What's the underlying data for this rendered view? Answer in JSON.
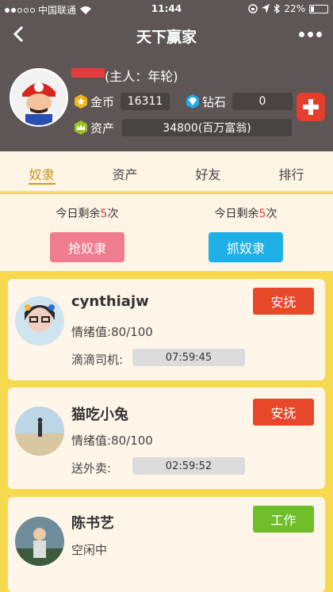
{
  "status": {
    "carrier": "中国联通",
    "time": "11:44",
    "battery": "22%",
    "battery_level": 0.22
  },
  "nav": {
    "title": "天下赢家"
  },
  "profile": {
    "owner": "(主人：年轮)",
    "gold_label": "金币",
    "gold_value": "16311",
    "diamond_label": "钻石",
    "diamond_value": "0",
    "assets_label": "资产",
    "assets_value": "34800(百万富翁)"
  },
  "tabs": [
    {
      "label": "奴隶"
    },
    {
      "label": "资产"
    },
    {
      "label": "好友"
    },
    {
      "label": "排行"
    }
  ],
  "actions": [
    {
      "prefix": "今日剩余",
      "count": "5",
      "suffix": "次",
      "button": "抢奴隶",
      "color": "#f07c90"
    },
    {
      "prefix": "今日剩余",
      "count": "5",
      "suffix": "次",
      "button": "抓奴隶",
      "color": "#1eb0e6"
    }
  ],
  "slaves": [
    {
      "name": "cynthiajw",
      "mood_label": "情绪值:",
      "mood": "80/100",
      "job": "滴滴司机:",
      "timer": "07:59:45",
      "button": "安抚",
      "button_color": "#e8482a"
    },
    {
      "name": "猫吃小兔",
      "mood_label": "情绪值:",
      "mood": "80/100",
      "job": "送外卖:",
      "timer": "02:59:52",
      "button": "安抚",
      "button_color": "#e8482a"
    },
    {
      "name": "陈书艺",
      "status": "空闲中",
      "button": "工作",
      "button_color": "#6fbf2a"
    }
  ],
  "colors": {
    "header": "#5e5555",
    "accent": "#c9971c",
    "background": "#f6d94e"
  }
}
